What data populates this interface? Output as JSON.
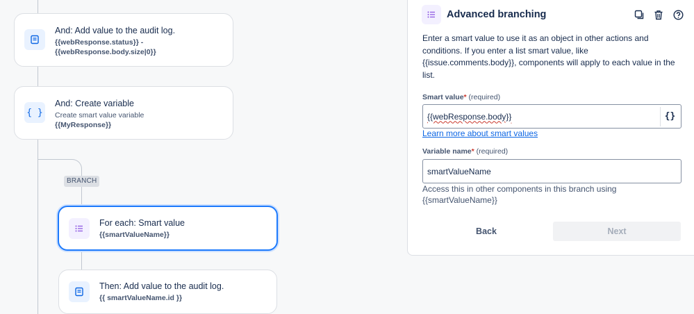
{
  "canvas": {
    "cards": [
      {
        "title": "And: Add value to the audit log.",
        "sub": "",
        "code1": "{{webResponse.status}} -",
        "code2": "{{webResponse.body.size|0}}",
        "icon": "document-icon"
      },
      {
        "title": "And: Create variable",
        "sub": "Create smart value variable",
        "code1": "{{MyResponse}}",
        "icon": "curly-braces-icon"
      },
      {
        "title": "For each: Smart value",
        "code1": "{{smartValueName}}",
        "icon": "list-icon"
      },
      {
        "title": "Then: Add value to the audit log.",
        "code1": "{{ smartValueName.id }}",
        "icon": "document-icon"
      }
    ],
    "branch_label": "BRANCH"
  },
  "panel": {
    "title": "Advanced branching",
    "description": "Enter a smart value to use it as an object in other actions and conditions. If you enter a list smart value, like {{issue.comments.body}}, components will apply to each value in the list.",
    "smart_value": {
      "label": "Smart value",
      "required_mark": "*",
      "required_text": "(required)",
      "value": "{{webResponse.body}}",
      "button": "{}"
    },
    "learn_more": "Learn more about smart values",
    "variable_name": {
      "label": "Variable name",
      "required_mark": "*",
      "required_text": "(required)",
      "value": "smartValueName"
    },
    "help": "Access this in other components in this branch using {{smartValueName}}",
    "back": "Back",
    "next": "Next"
  },
  "colors": {
    "accent": "#1d7afc",
    "purple": "#8f59e2",
    "blue": "#0c66e4"
  }
}
